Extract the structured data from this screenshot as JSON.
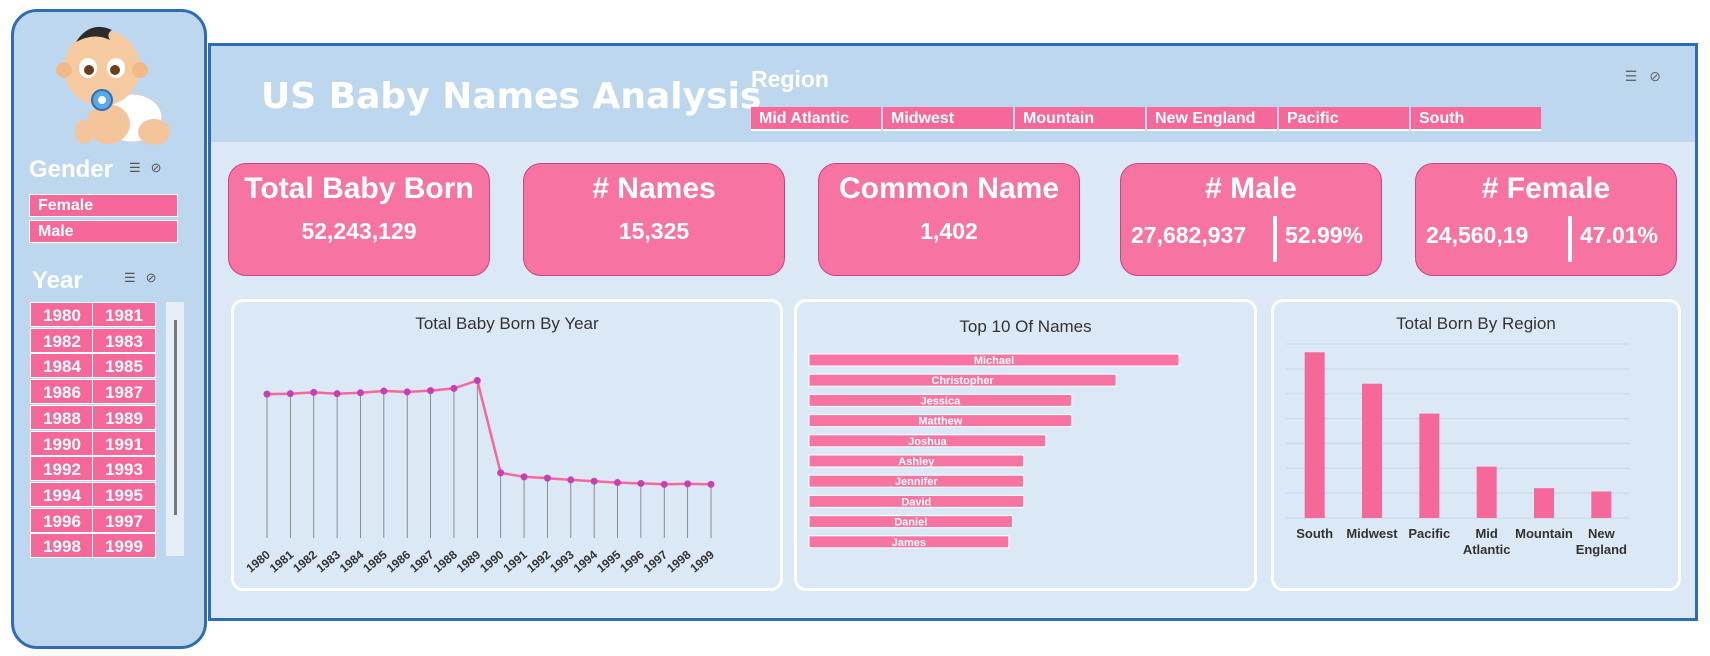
{
  "sidebar": {
    "gender_title": "Gender",
    "gender_items": [
      "Female",
      "Male"
    ],
    "year_title": "Year",
    "years": [
      "1980",
      "1981",
      "1982",
      "1983",
      "1984",
      "1985",
      "1986",
      "1987",
      "1988",
      "1989",
      "1990",
      "1991",
      "1992",
      "1993",
      "1994",
      "1995",
      "1996",
      "1997",
      "1998",
      "1999"
    ]
  },
  "header": {
    "title": "US Baby Names Analysis",
    "region_title": "Region",
    "regions": [
      "Mid Atlantic",
      "Midwest",
      "Mountain",
      "New England",
      "Pacific",
      "South"
    ]
  },
  "kpis": {
    "total": {
      "title": "Total Baby Born",
      "value": "52,243,129"
    },
    "names": {
      "title": "# Names",
      "value": "15,325"
    },
    "common": {
      "title": "Common Name",
      "value": "1,402"
    },
    "male": {
      "title": "# Male",
      "value": "27,682,937",
      "pct": "52.99%"
    },
    "female": {
      "title": "# Female",
      "value": "24,560,19",
      "pct": "47.01%"
    }
  },
  "colors": {
    "accent": "#f6679a",
    "border": "#2e6db4",
    "panel_bg": "#dbe8f5",
    "header_bg": "#bdd7ee"
  },
  "chart_data": [
    {
      "type": "line",
      "title": "Total Baby Born By Year",
      "x": [
        "1980",
        "1981",
        "1982",
        "1983",
        "1984",
        "1985",
        "1986",
        "1987",
        "1988",
        "1989",
        "1990",
        "1991",
        "1992",
        "1993",
        "1994",
        "1995",
        "1996",
        "1997",
        "1998",
        "1999"
      ],
      "values": [
        3.27,
        3.28,
        3.31,
        3.28,
        3.3,
        3.34,
        3.32,
        3.35,
        3.4,
        3.58,
        1.48,
        1.39,
        1.36,
        1.32,
        1.29,
        1.26,
        1.24,
        1.22,
        1.23,
        1.22
      ],
      "grid": false
    },
    {
      "type": "bar",
      "orientation": "horizontal",
      "title": "Top 10 Of Names",
      "categories": [
        "Michael",
        "Christopher",
        "Jessica",
        "Matthew",
        "Joshua",
        "Ashley",
        "Jennifer",
        "David",
        "Daniel",
        "James"
      ],
      "values": [
        100,
        83,
        71,
        71,
        64,
        58,
        58,
        58,
        55,
        54
      ]
    },
    {
      "type": "bar",
      "title": "Total Born By Region",
      "categories": [
        "South",
        "Midwest",
        "Pacific",
        "Mid\nAtlantic",
        "Mountain",
        "New\nEngland"
      ],
      "values": [
        100,
        81,
        63,
        31,
        18,
        16
      ],
      "grid": true
    }
  ]
}
